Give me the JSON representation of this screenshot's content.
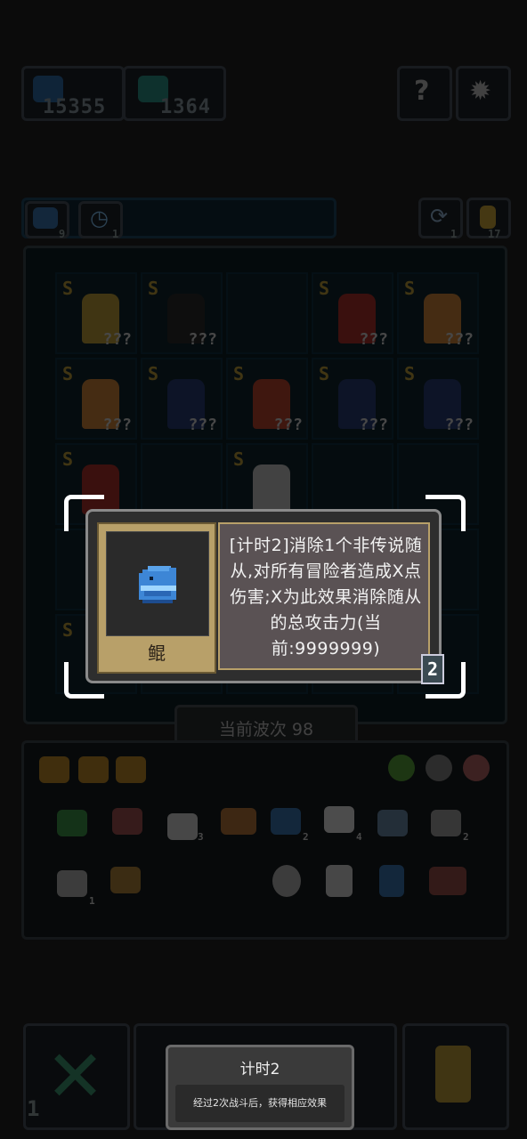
{
  "header": {
    "coins": "15355",
    "gems": "1364"
  },
  "toolbar_counts": {
    "left_a": "9",
    "left_b": "1",
    "right_a": "1",
    "right_b": "17"
  },
  "grid": {
    "grade_label": "S",
    "unknown_label": "???"
  },
  "wave_label": "当前波次 98",
  "inventory": {
    "counts": [
      "3",
      "2",
      "4",
      "2",
      "1"
    ]
  },
  "popup": {
    "item_name": "鲲",
    "description": "[计时2]消除1个非传说随从,对所有冒险者造成X点伤害;X为此效果消除随从的总攻击力(当前:9999999)",
    "count": "2",
    "item_icon": "blue-whale-icon"
  },
  "bottom": {
    "left_count": "1"
  },
  "toast": {
    "title": "计时2",
    "body": "经过2次战斗后，获得相应效果"
  },
  "colors": {
    "popup_gold": "#b8a069",
    "popup_bg": "#2e2e2e",
    "grade": "#c9a53a"
  }
}
